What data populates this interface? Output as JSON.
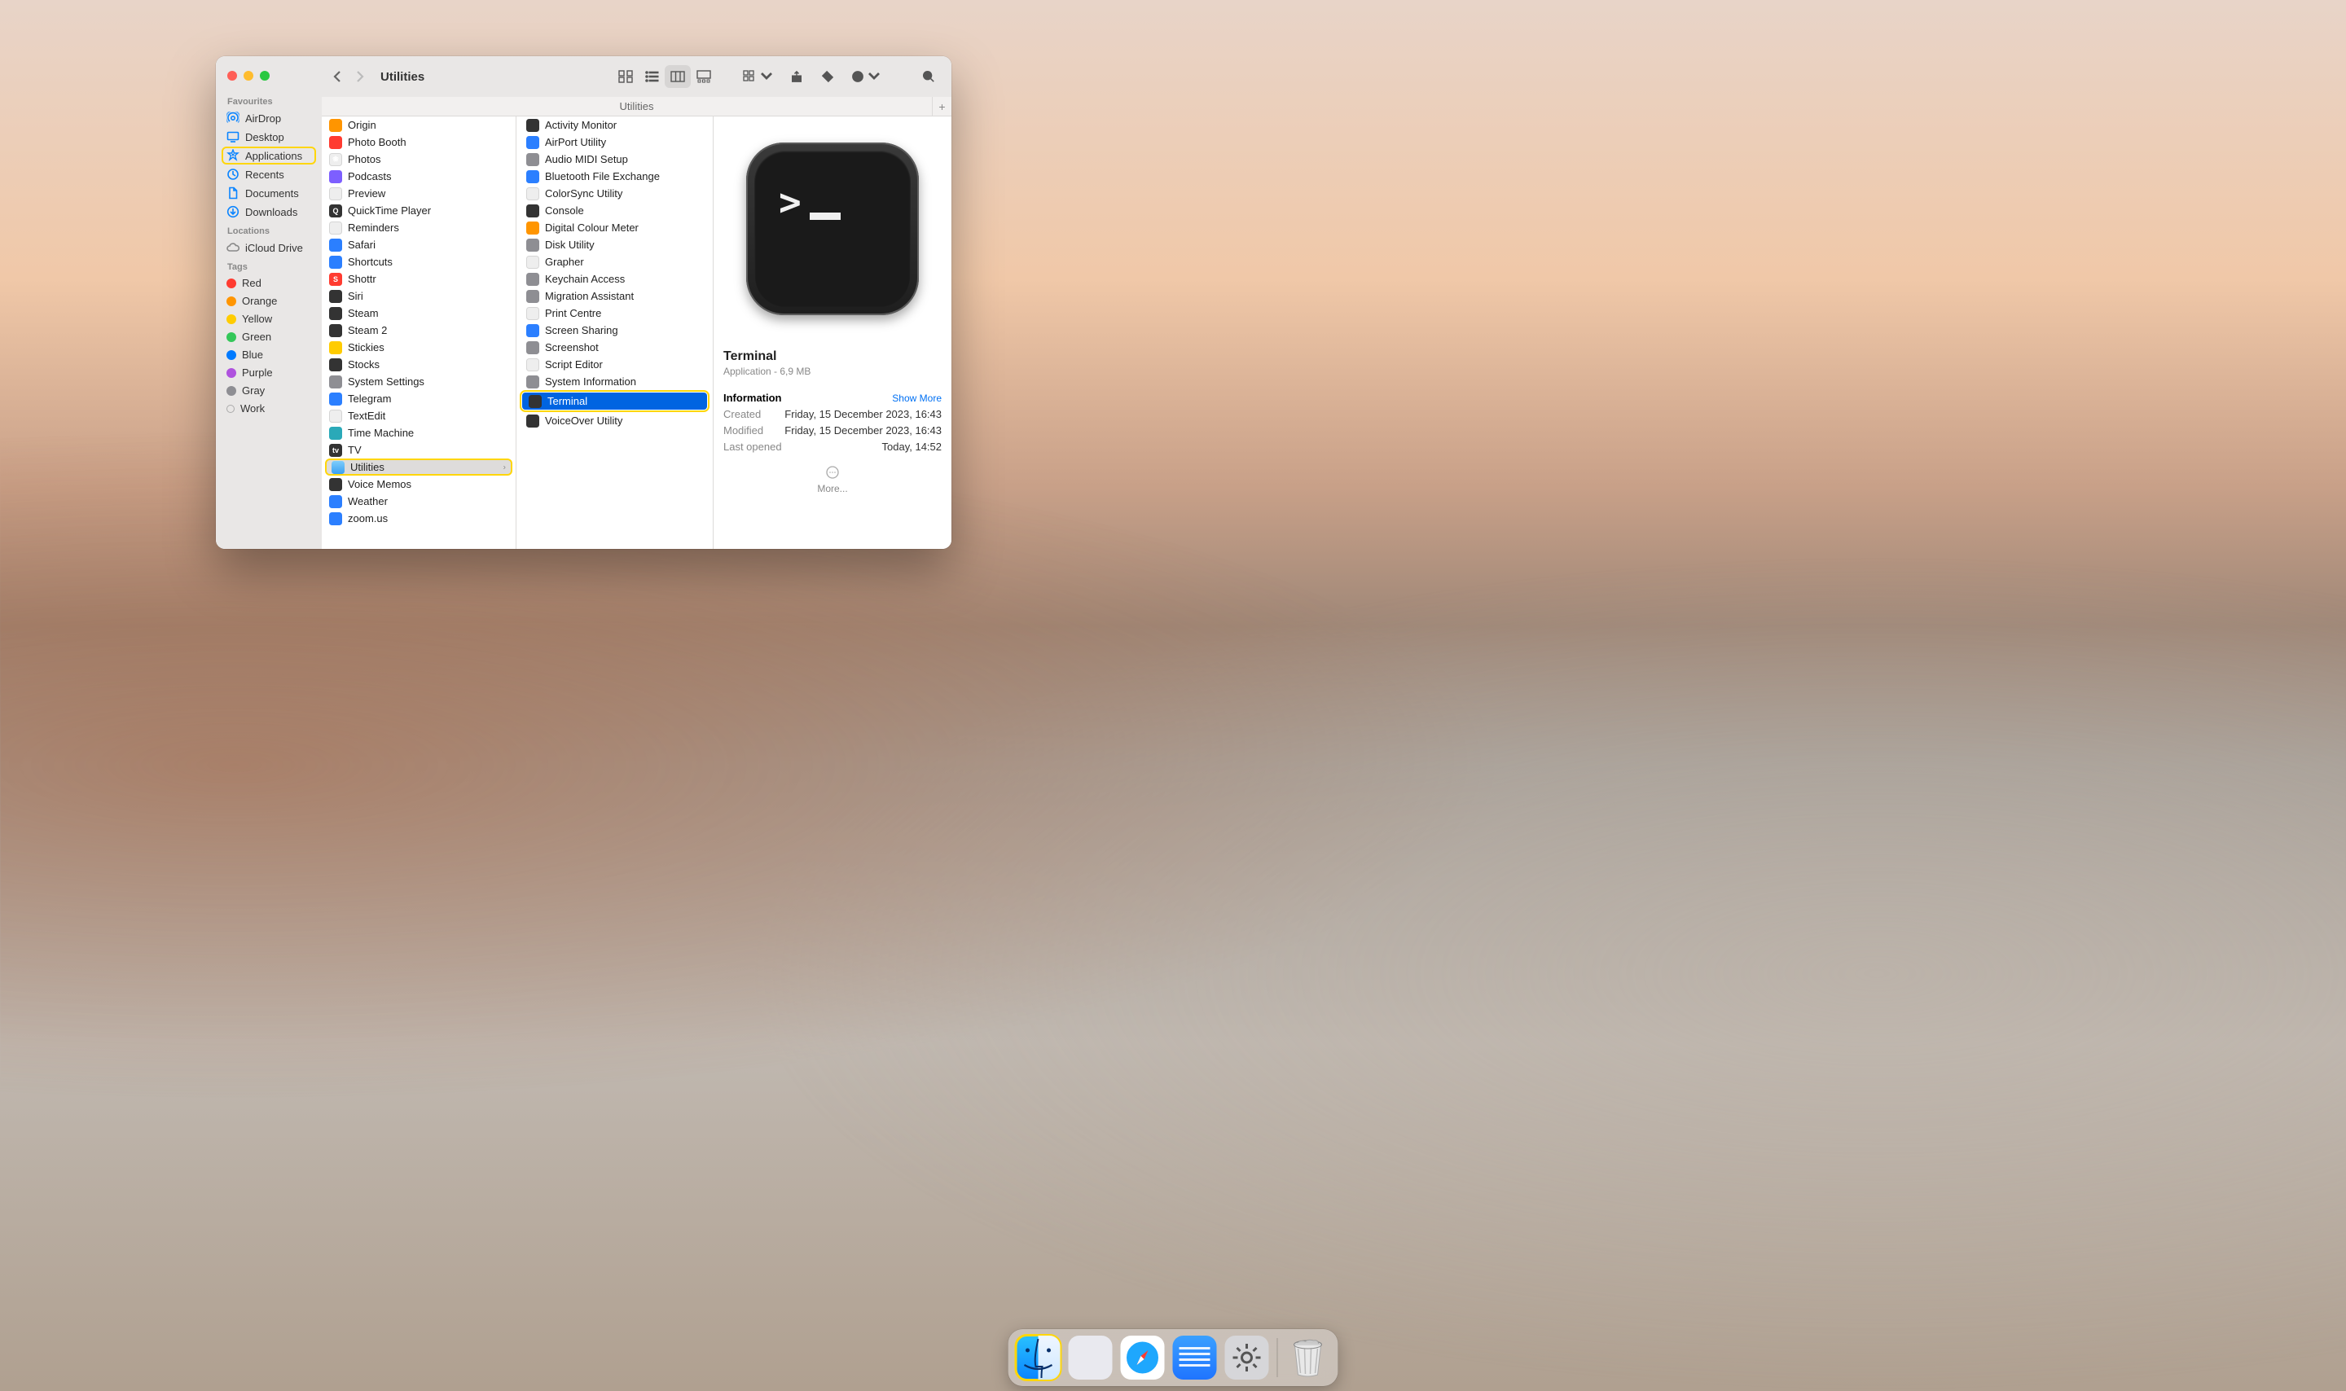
{
  "window": {
    "title": "Utilities",
    "path_bar": "Utilities"
  },
  "sidebar": {
    "sections": [
      {
        "header": "Favourites",
        "items": [
          {
            "label": "AirDrop",
            "icon": "airdrop"
          },
          {
            "label": "Desktop",
            "icon": "desktop"
          },
          {
            "label": "Applications",
            "icon": "apps",
            "highlighted": true
          },
          {
            "label": "Recents",
            "icon": "recents"
          },
          {
            "label": "Documents",
            "icon": "documents"
          },
          {
            "label": "Downloads",
            "icon": "downloads"
          }
        ]
      },
      {
        "header": "Locations",
        "items": [
          {
            "label": "iCloud Drive",
            "icon": "icloud"
          }
        ]
      },
      {
        "header": "Tags",
        "items": [
          {
            "label": "Red",
            "tag": "#ff3b30"
          },
          {
            "label": "Orange",
            "tag": "#ff9500"
          },
          {
            "label": "Yellow",
            "tag": "#ffcc00"
          },
          {
            "label": "Green",
            "tag": "#34c759"
          },
          {
            "label": "Blue",
            "tag": "#007aff"
          },
          {
            "label": "Purple",
            "tag": "#af52de"
          },
          {
            "label": "Gray",
            "tag": "#8e8e93"
          },
          {
            "label": "Work",
            "tag": "ring"
          }
        ]
      }
    ]
  },
  "columns": {
    "applications": [
      {
        "label": "Origin",
        "c": "ai-orange"
      },
      {
        "label": "Photo Booth",
        "c": "ai-red"
      },
      {
        "label": "Photos",
        "c": "ai-white",
        "t": "❀"
      },
      {
        "label": "Podcasts",
        "c": "ai-purple"
      },
      {
        "label": "Preview",
        "c": "ai-white"
      },
      {
        "label": "QuickTime Player",
        "c": "ai-dark",
        "t": "Q"
      },
      {
        "label": "Reminders",
        "c": "ai-white"
      },
      {
        "label": "Safari",
        "c": "ai-blue"
      },
      {
        "label": "Shortcuts",
        "c": "ai-blue"
      },
      {
        "label": "Shottr",
        "c": "ai-red",
        "t": "S"
      },
      {
        "label": "Siri",
        "c": "ai-dark"
      },
      {
        "label": "Steam",
        "c": "ai-dark"
      },
      {
        "label": "Steam 2",
        "c": "ai-dark"
      },
      {
        "label": "Stickies",
        "c": "ai-yellow"
      },
      {
        "label": "Stocks",
        "c": "ai-dark"
      },
      {
        "label": "System Settings",
        "c": "ai-gray"
      },
      {
        "label": "Telegram",
        "c": "ai-blue"
      },
      {
        "label": "TextEdit",
        "c": "ai-white"
      },
      {
        "label": "Time Machine",
        "c": "ai-teal"
      },
      {
        "label": "TV",
        "c": "ai-dark",
        "t": "tv"
      },
      {
        "label": "Utilities",
        "c": "ai-folder",
        "folder": true,
        "highlighted": true,
        "open": true
      },
      {
        "label": "Voice Memos",
        "c": "ai-dark"
      },
      {
        "label": "Weather",
        "c": "ai-blue"
      },
      {
        "label": "zoom.us",
        "c": "ai-blue"
      }
    ],
    "utilities": [
      {
        "label": "Activity Monitor",
        "c": "ai-dark"
      },
      {
        "label": "AirPort Utility",
        "c": "ai-blue"
      },
      {
        "label": "Audio MIDI Setup",
        "c": "ai-gray"
      },
      {
        "label": "Bluetooth File Exchange",
        "c": "ai-blue"
      },
      {
        "label": "ColorSync Utility",
        "c": "ai-white"
      },
      {
        "label": "Console",
        "c": "ai-dark"
      },
      {
        "label": "Digital Colour Meter",
        "c": "ai-orange"
      },
      {
        "label": "Disk Utility",
        "c": "ai-gray"
      },
      {
        "label": "Grapher",
        "c": "ai-white"
      },
      {
        "label": "Keychain Access",
        "c": "ai-gray"
      },
      {
        "label": "Migration Assistant",
        "c": "ai-gray"
      },
      {
        "label": "Print Centre",
        "c": "ai-white"
      },
      {
        "label": "Screen Sharing",
        "c": "ai-blue"
      },
      {
        "label": "Screenshot",
        "c": "ai-gray"
      },
      {
        "label": "Script Editor",
        "c": "ai-white"
      },
      {
        "label": "System Information",
        "c": "ai-gray"
      },
      {
        "label": "Terminal",
        "c": "ai-dark",
        "selected": true,
        "highlighted": true
      },
      {
        "label": "VoiceOver Utility",
        "c": "ai-dark"
      }
    ]
  },
  "preview": {
    "name": "Terminal",
    "kind": "Application - 6,9 MB",
    "info_header": "Information",
    "show_more": "Show More",
    "rows": [
      {
        "k": "Created",
        "v": "Friday, 15 December 2023, 16:43"
      },
      {
        "k": "Modified",
        "v": "Friday, 15 December 2023, 16:43"
      },
      {
        "k": "Last opened",
        "v": "Today, 14:52"
      }
    ],
    "more": "More..."
  },
  "dock": {
    "items": [
      {
        "name": "finder",
        "highlighted": true
      },
      {
        "name": "launchpad"
      },
      {
        "name": "safari"
      },
      {
        "name": "notes"
      },
      {
        "name": "system-settings"
      }
    ],
    "trash": "trash"
  }
}
